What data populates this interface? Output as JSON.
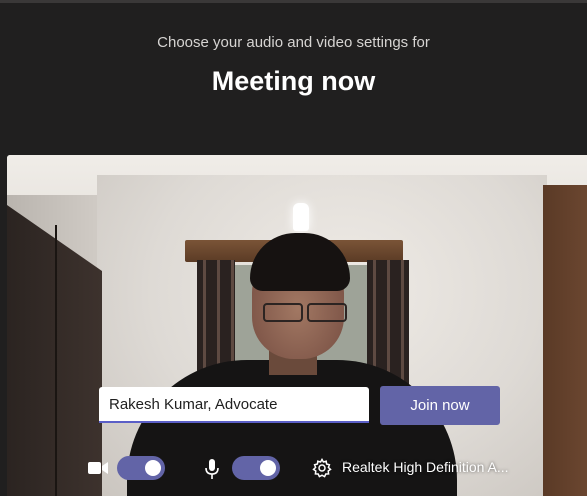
{
  "header": {
    "subtitle": "Choose your audio and video settings for",
    "title": "Meeting now"
  },
  "join": {
    "name_value": "Rakesh Kumar, Advocate",
    "join_label": "Join now"
  },
  "controls": {
    "camera_on": true,
    "mic_on": true,
    "audio_device": "Realtek High Definition A..."
  },
  "colors": {
    "background": "#201f1f",
    "accent": "#6264a7",
    "input_underline": "#5b5fc7"
  },
  "icons": [
    "camera-icon",
    "microphone-icon",
    "gear-icon"
  ]
}
